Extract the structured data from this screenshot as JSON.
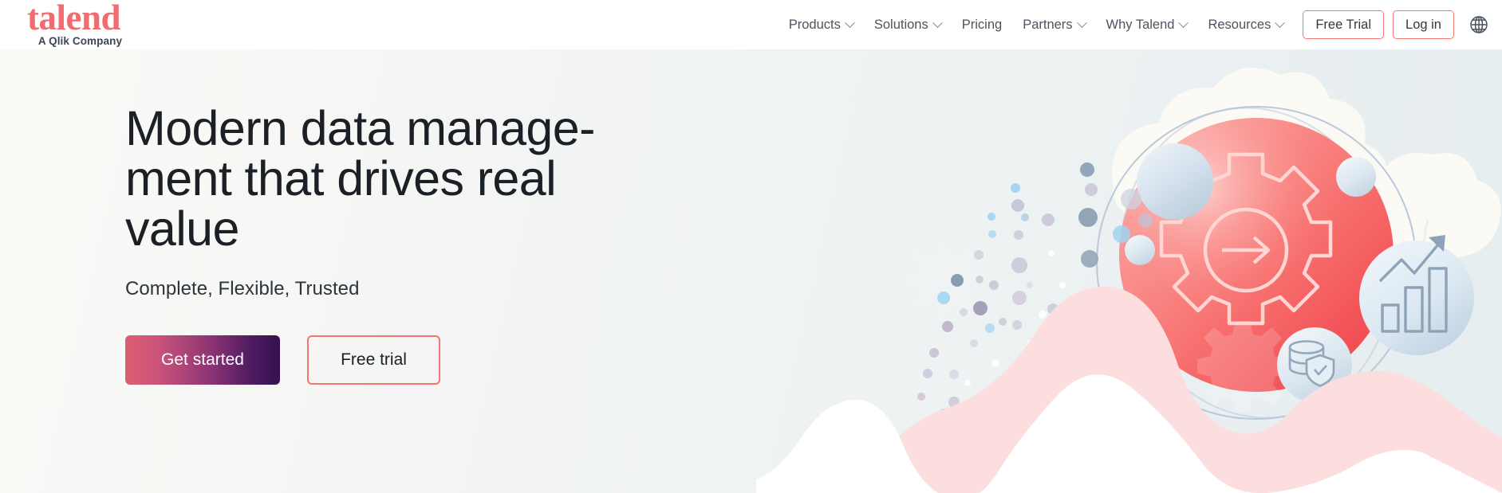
{
  "brand": {
    "logo_word": "talend",
    "logo_tagline": "A Qlik Company",
    "logo_color": "#f16c70",
    "accent_coral": "#f5766e",
    "cta_gradient_from": "#dc5e71",
    "cta_gradient_to": "#33124f"
  },
  "header": {
    "nav": [
      {
        "label": "Products",
        "has_caret": true
      },
      {
        "label": "Solutions",
        "has_caret": true
      },
      {
        "label": "Pricing",
        "has_caret": false
      },
      {
        "label": "Partners",
        "has_caret": true
      },
      {
        "label": "Why Talend",
        "has_caret": true
      },
      {
        "label": "Resources",
        "has_caret": true
      }
    ],
    "free_trial_label": "Free Trial",
    "login_label": "Log in",
    "language_icon": "globe-icon"
  },
  "hero": {
    "title": "Modern data manage-\nment that drives real\nvalue",
    "subtitle": "Complete, Flexible, Trusted",
    "primary_cta": "Get started",
    "secondary_cta": "Free trial",
    "illustration": {
      "main_circle_icon": "gear-with-arrow-icon",
      "badge_icons": [
        "database-shield-check-icon",
        "bar-chart-trending-up-icon"
      ],
      "decorations": [
        "orbital-ring",
        "cloud-shapes",
        "sphere-shapes",
        "dot-scatter-trail",
        "pink-wave",
        "white-wave"
      ]
    }
  }
}
